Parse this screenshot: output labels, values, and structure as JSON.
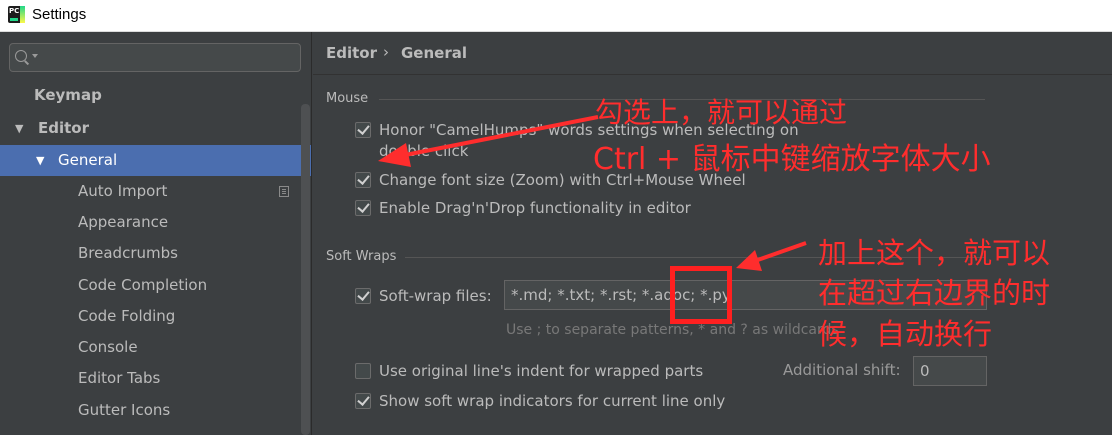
{
  "window": {
    "title": "Settings",
    "app_icon_text": "PC"
  },
  "sidebar": {
    "search_placeholder": "",
    "items": [
      {
        "label": "Keymap"
      },
      {
        "label": "Editor"
      },
      {
        "label": "General"
      },
      {
        "label": "Auto Import"
      },
      {
        "label": "Appearance"
      },
      {
        "label": "Breadcrumbs"
      },
      {
        "label": "Code Completion"
      },
      {
        "label": "Code Folding"
      },
      {
        "label": "Console"
      },
      {
        "label": "Editor Tabs"
      },
      {
        "label": "Gutter Icons"
      }
    ]
  },
  "breadcrumb": {
    "parent": "Editor",
    "separator": "›",
    "current": "General"
  },
  "mouse": {
    "title": "Mouse",
    "options": [
      {
        "label_line1": "Honor \"CamelHumps\" words settings when selecting on",
        "label_line2": "double click",
        "checked": true
      },
      {
        "label": "Change font size (Zoom) with Ctrl+Mouse Wheel",
        "checked": true
      },
      {
        "label": "Enable Drag'n'Drop functionality in editor",
        "checked": true
      }
    ]
  },
  "soft_wraps": {
    "title": "Soft Wraps",
    "files_label": "Soft-wrap files:",
    "files_value": "*.md; *.txt; *.rst; *.adoc; *.py",
    "hint": "Use ; to separate patterns, * and ? as wildcards",
    "indent_label": "Use original line's indent for wrapped parts",
    "indent_checked": false,
    "shift_label": "Additional shift:",
    "shift_value": "0",
    "indicators_label": "Show soft wrap indicators for current line only",
    "indicators_checked": true
  },
  "annotations": {
    "top_line1": "勾选上，就可以通过",
    "top_line2": "Ctrl + 鼠标中键缩放字体大小",
    "right_line1": "加上这个，就可以",
    "right_line2": "在超过右边界的时",
    "right_line3": "候，自动换行"
  },
  "colors": {
    "background": "#3c3f41",
    "selection": "#4b6eaf",
    "annotation_red": "#ff2d2d"
  }
}
